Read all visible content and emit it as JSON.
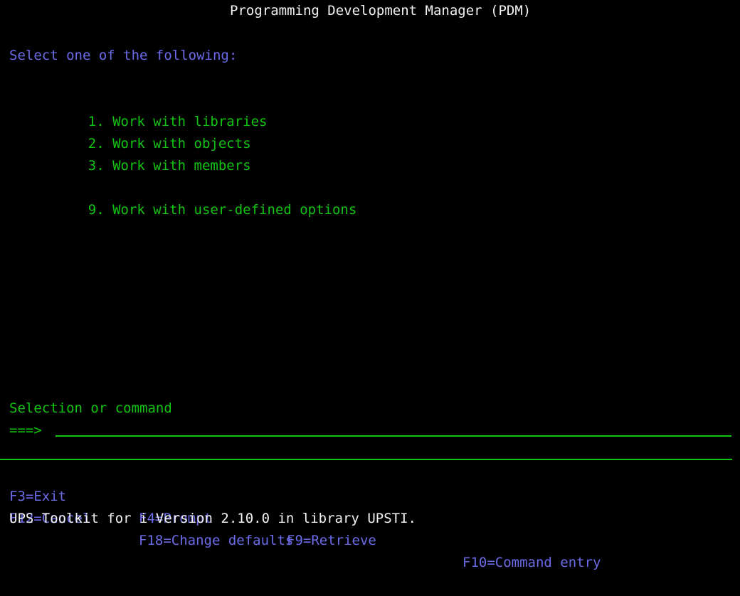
{
  "screen": {
    "title": "Programming Development Manager (PDM)",
    "prompt_heading": "Select one of the following:",
    "menu_items": [
      {
        "number": "1.",
        "label": "Work with libraries"
      },
      {
        "number": "2.",
        "label": "Work with objects"
      },
      {
        "number": "3.",
        "label": "Work with members"
      },
      {
        "number": "9.",
        "label": "Work with user-defined options"
      }
    ],
    "selection_label": "Selection or command",
    "command_arrow": "===>",
    "command_value": "",
    "function_keys_row1": [
      {
        "key": "F3",
        "label": "Exit",
        "text": "F3=Exit"
      },
      {
        "key": "F4",
        "label": "Prompt",
        "text": "F4=Prompt"
      },
      {
        "key": "F9",
        "label": "Retrieve",
        "text": "F9=Retrieve"
      },
      {
        "key": "F10",
        "label": "Command entry",
        "text": "F10=Command entry"
      }
    ],
    "function_keys_row2": [
      {
        "key": "F12",
        "label": "Cancel",
        "text": "F12=Cancel"
      },
      {
        "key": "F18",
        "label": "Change defaults",
        "text": "F18=Change defaults"
      }
    ],
    "status_message": "UPS Toolkit for i Version 2.10.0 in library UPSTI.",
    "colors": {
      "background": "#000000",
      "title": "#f2f2f2",
      "heading_blue": "#6b6be8",
      "menu_green": "#12c512",
      "function_key_blue": "#6b6be8",
      "status_white": "#f2f2f2",
      "rule_green": "#12c512"
    }
  }
}
